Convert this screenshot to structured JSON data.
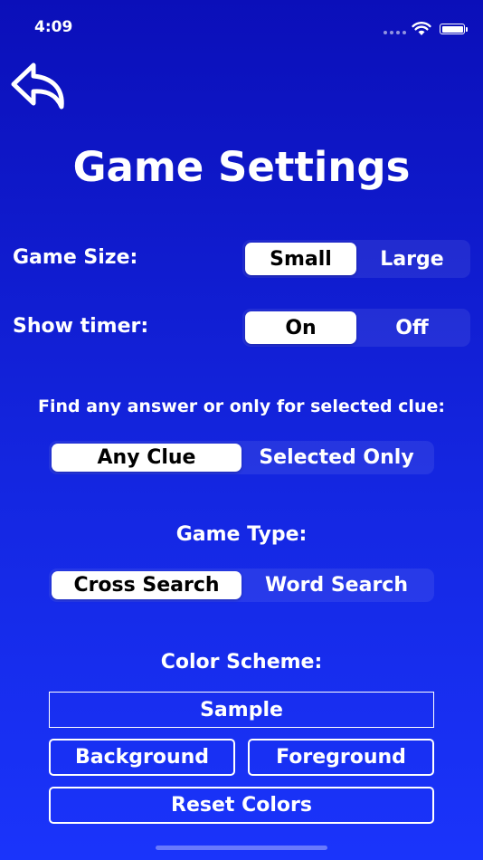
{
  "status_bar": {
    "time": "4:09",
    "wifi_icon": "wifi-icon",
    "battery_icon": "battery-icon"
  },
  "header": {
    "back_icon": "back-arrow-icon",
    "title": "Game Settings"
  },
  "settings": {
    "game_size": {
      "label": "Game Size:",
      "options": [
        "Small",
        "Large"
      ],
      "selected": "Small"
    },
    "show_timer": {
      "label": "Show timer:",
      "options": [
        "On",
        "Off"
      ],
      "selected": "On"
    },
    "find_mode": {
      "label": "Find any answer or only for selected clue:",
      "options": [
        "Any Clue",
        "Selected Only"
      ],
      "selected": "Any Clue"
    },
    "game_type": {
      "label": "Game Type:",
      "options": [
        "Cross Search",
        "Word Search"
      ],
      "selected": "Cross Search"
    },
    "color_scheme": {
      "label": "Color Scheme:",
      "sample": "Sample",
      "background_button": "Background",
      "foreground_button": "Foreground",
      "reset_button": "Reset Colors"
    }
  },
  "colors": {
    "background_top": "#0b0fb9",
    "background_bottom": "#1a34fb",
    "text": "#ffffff",
    "segment_selected": "#ffffff"
  }
}
